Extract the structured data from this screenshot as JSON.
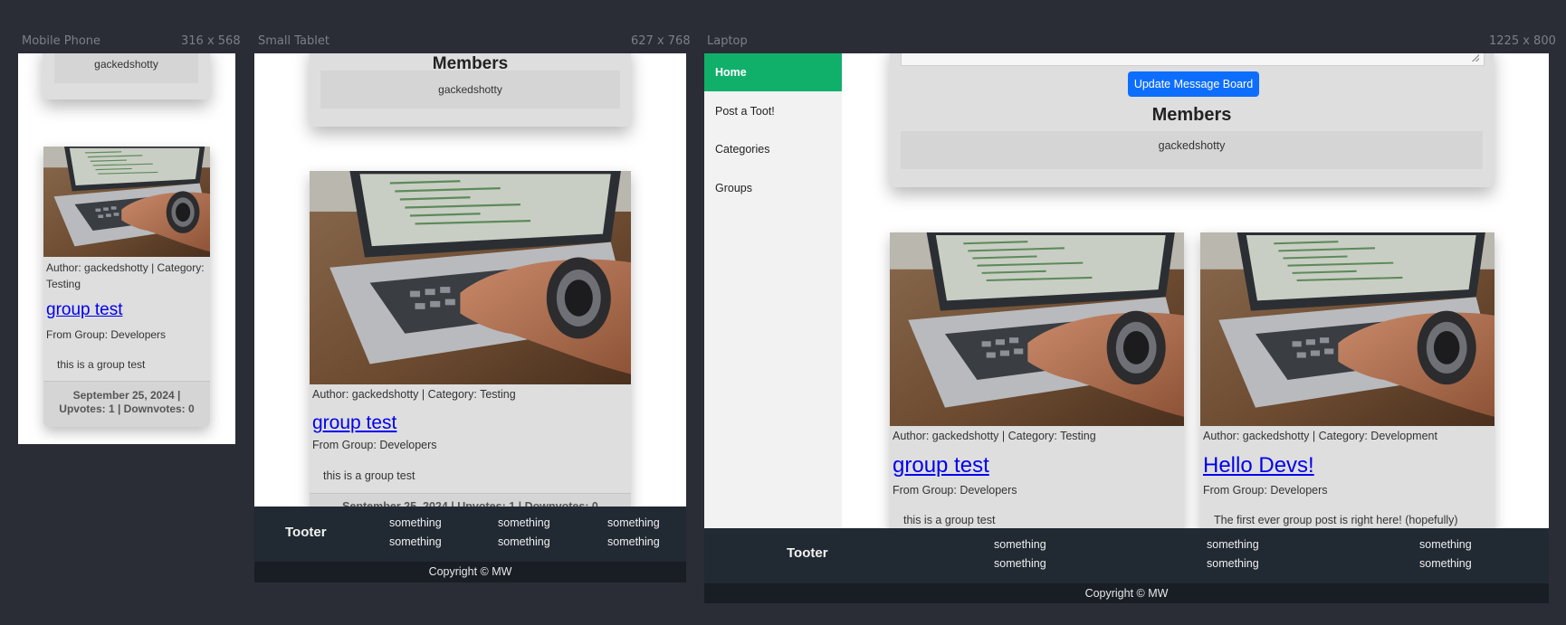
{
  "devices": {
    "phone": {
      "name": "Mobile Phone",
      "size": "316 x 568"
    },
    "tablet": {
      "name": "Small Tablet",
      "size": "627 x 768"
    },
    "laptop": {
      "name": "Laptop",
      "size": "1225 x 800"
    }
  },
  "members": {
    "title": "Members",
    "items": [
      "gackedshotty"
    ]
  },
  "message_board": {
    "update_button": "Update Message Board"
  },
  "sidebar": {
    "items": [
      {
        "label": "Home",
        "active": true
      },
      {
        "label": "Post a Toot!"
      },
      {
        "label": "Categories"
      },
      {
        "label": "Groups"
      }
    ]
  },
  "posts": [
    {
      "meta": "Author: gackedshotty | Category: Testing",
      "title": "group test",
      "group": "From Group: Developers",
      "body": "this is a group test",
      "footer": "September 25, 2024 | Upvotes: 1 | Downvotes: 0"
    },
    {
      "meta": "Author: gackedshotty | Category: Development",
      "title": "Hello Devs!",
      "group": "From Group: Developers",
      "body": "The first ever group post is right here! (hopefully)"
    }
  ],
  "footer": {
    "brand": "Tooter",
    "links": [
      "something",
      "something",
      "something",
      "something",
      "something",
      "something"
    ],
    "copyright": "Copyright © MW"
  },
  "colors": {
    "accent": "#10b06b",
    "button": "#0d6efd",
    "footer": "#212932"
  }
}
